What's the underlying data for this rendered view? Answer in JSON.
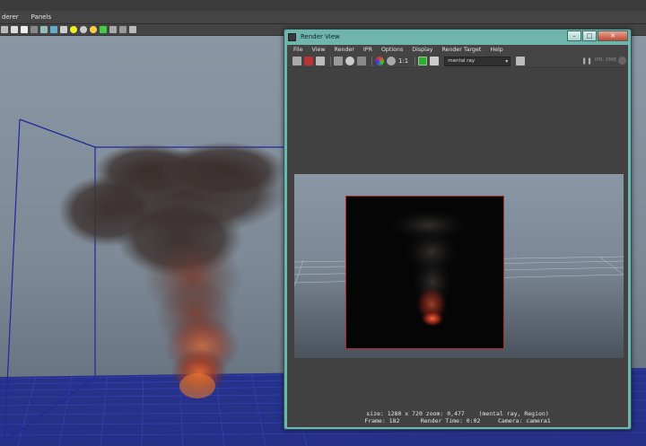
{
  "maya": {
    "menus": [
      "derer",
      "Panels"
    ]
  },
  "render_view": {
    "title": "Render View",
    "window_buttons": {
      "minimize": "–",
      "maximize": "□",
      "close": "✕"
    },
    "menus": [
      "File",
      "View",
      "Render",
      "IPR",
      "Options",
      "Display",
      "Render Target",
      "Help"
    ],
    "toolbar": {
      "ratio_label": "1:1",
      "renderer": "mental ray",
      "ipr_status": "IPR: 0MB"
    },
    "info": {
      "line1": "size: 1280 x 720 zoom: 0,477    (mental ray, Region)",
      "line2": "Frame: 182      Render Time: 0:02     Camera: camera1"
    }
  },
  "colors": {
    "window_frame": "#6fb4ad",
    "region_border": "#b12a2a",
    "grid_lines": "#2b35a8",
    "bounding_box": "#1d2a9a"
  }
}
